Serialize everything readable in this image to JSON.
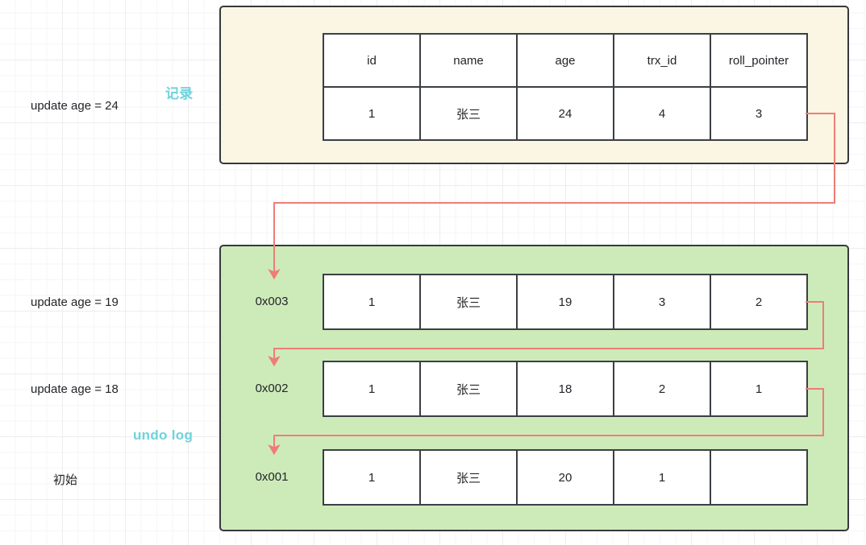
{
  "diagram": {
    "title": "MySQL InnoDB undo log version chain",
    "colors": {
      "record_region_fill": "#faf6e3",
      "undolog_region_fill": "#cdebb9",
      "region_border": "#36393d",
      "caption_text": "#6fd3dc",
      "arrow": "#ee7d76",
      "cell_border": "#3a3f44",
      "cell_fill": "#ffffff",
      "text": "#222529",
      "grid_minor": "#f6f6f6",
      "grid_major": "#ededed"
    },
    "captions": {
      "record": "记录",
      "undolog": "undo log"
    },
    "steps": [
      {
        "label": "update age = 24"
      },
      {
        "label": "update age = 19"
      },
      {
        "label": "update age = 18"
      },
      {
        "label": "初始"
      }
    ],
    "columns": [
      "id",
      "name",
      "age",
      "trx_id",
      "roll_pointer"
    ],
    "record_row": {
      "id": "1",
      "name": "张三",
      "age": "24",
      "trx_id": "4",
      "roll_pointer": "3"
    },
    "undo_rows": [
      {
        "address": "0x003",
        "id": "1",
        "name": "张三",
        "age": "19",
        "trx_id": "3",
        "roll_pointer": "2"
      },
      {
        "address": "0x002",
        "id": "1",
        "name": "张三",
        "age": "18",
        "trx_id": "2",
        "roll_pointer": "1"
      },
      {
        "address": "0x001",
        "id": "1",
        "name": "张三",
        "age": "20",
        "trx_id": "1",
        "roll_pointer": ""
      }
    ],
    "arrows": [
      {
        "name": "record-to-0x003",
        "from": "record.roll_pointer",
        "to": "0x003"
      },
      {
        "name": "0x003-to-0x002",
        "from": "0x003.roll_pointer",
        "to": "0x002"
      },
      {
        "name": "0x002-to-0x001",
        "from": "0x002.roll_pointer",
        "to": "0x001"
      }
    ]
  }
}
